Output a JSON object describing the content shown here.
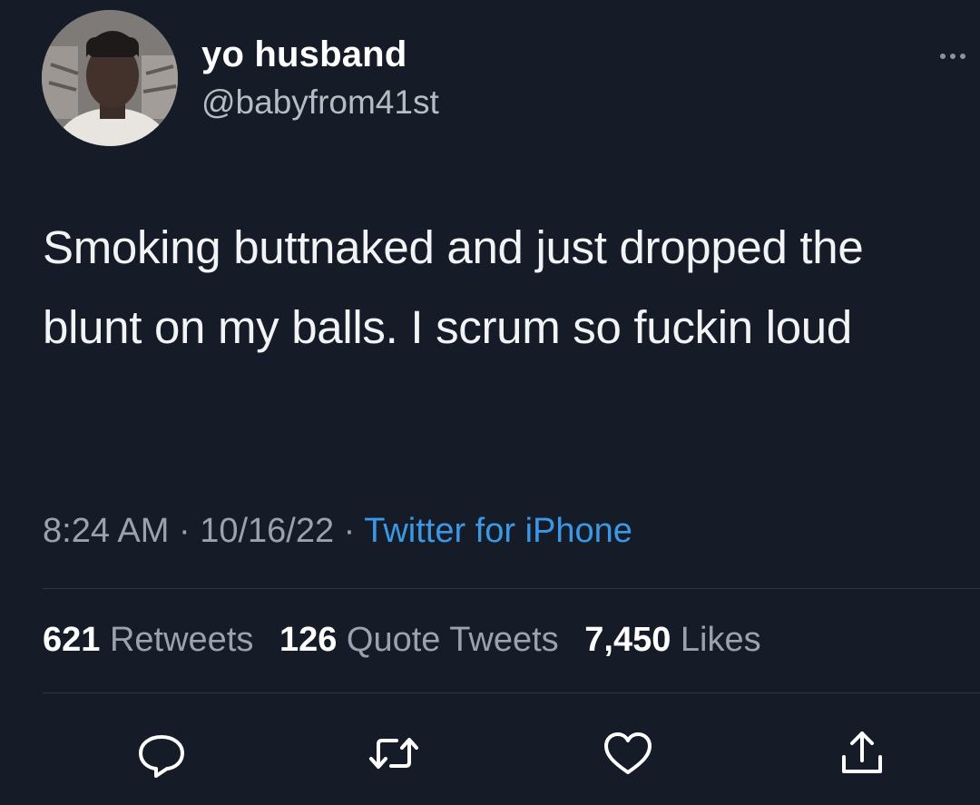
{
  "author": {
    "name": "yo husband",
    "handle": "@babyfrom41st"
  },
  "tweet": {
    "text": "Smoking buttnaked and just dropped the blunt on my balls. I scrum so fuckin loud",
    "time": "8:24 AM",
    "date": "10/16/22",
    "source": "Twitter for iPhone",
    "separator": " · "
  },
  "stats": {
    "retweets_count": "621",
    "retweets_label": "Retweets",
    "quotes_count": "126",
    "quotes_label": "Quote Tweets",
    "likes_count": "7,450",
    "likes_label": "Likes"
  },
  "actions": [
    {
      "icon": "reply-icon"
    },
    {
      "icon": "retweet-icon"
    },
    {
      "icon": "like-icon"
    },
    {
      "icon": "share-icon"
    }
  ],
  "colors": {
    "background": "#161c27",
    "link": "#3b98e6",
    "muted": "#9aa3ad"
  }
}
